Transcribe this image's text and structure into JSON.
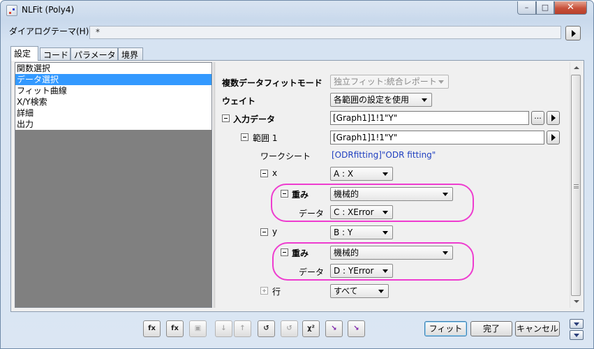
{
  "window": {
    "title": "NLFit (Poly4)",
    "min_icon": "minimize-icon",
    "max_icon": "maximize-icon",
    "close_icon": "close-icon"
  },
  "theme": {
    "label": "ダイアログテーマ(H)",
    "value": "*"
  },
  "tabs": [
    {
      "label": "設定",
      "active": true
    },
    {
      "label": "コード",
      "active": false
    },
    {
      "label": "パラメータ",
      "active": false
    },
    {
      "label": "境界",
      "active": false
    }
  ],
  "tree": {
    "items": [
      {
        "label": "関数選択",
        "selected": false
      },
      {
        "label": "データ選択",
        "selected": true
      },
      {
        "label": "フィット曲線",
        "selected": false
      },
      {
        "label": "X/Y検索",
        "selected": false
      },
      {
        "label": "詳細",
        "selected": false
      },
      {
        "label": "出力",
        "selected": false
      }
    ]
  },
  "props": {
    "multi_fit_mode": {
      "label": "複数データフィットモード",
      "value": "独立フィット:統合レポート"
    },
    "weight": {
      "label": "ウェイト",
      "value": "各範囲の設定を使用"
    },
    "input_data": {
      "label": "入力データ",
      "value": "[Graph1]1!1\"Y\"",
      "browse": "..."
    },
    "range1": {
      "label": "範囲 1",
      "value": "[Graph1]1!1\"Y\""
    },
    "worksheet": {
      "label": "ワークシート",
      "value": "[ODRfitting]\"ODR fitting\""
    },
    "x": {
      "label": "x",
      "value": "A : X"
    },
    "x_weight": {
      "label": "重み",
      "value": "機械的"
    },
    "x_data": {
      "label": "データ",
      "value": "C : XError"
    },
    "y": {
      "label": "y",
      "value": "B : Y"
    },
    "y_weight": {
      "label": "重み",
      "value": "機械的"
    },
    "y_data": {
      "label": "データ",
      "value": "D : YError"
    },
    "rows": {
      "label": "行",
      "value": "すべて"
    }
  },
  "toolbar": {
    "icons": [
      {
        "name": "fit-function-builder-icon",
        "glyph": "fx",
        "disabled": false
      },
      {
        "name": "function-organizer-icon",
        "glyph": "fx",
        "disabled": false
      },
      {
        "name": "save-icon",
        "glyph": "▣",
        "disabled": true
      },
      {
        "name": "sort-down-icon",
        "glyph": "↓",
        "disabled": true
      },
      {
        "name": "sort-up-icon",
        "glyph": "↑",
        "disabled": true
      },
      {
        "name": "init-params-icon",
        "glyph": "↺",
        "disabled": false
      },
      {
        "name": "simplex-icon",
        "glyph": "↺",
        "disabled": true
      },
      {
        "name": "chi-square-icon",
        "glyph": "χ²",
        "disabled": false
      },
      {
        "name": "one-iteration-icon",
        "glyph": "↘",
        "disabled": false
      },
      {
        "name": "fit-till-converged-icon",
        "glyph": "↘",
        "disabled": false
      }
    ]
  },
  "buttons": {
    "fit": "フィット",
    "done": "完了",
    "cancel": "キャンセル"
  },
  "colors": {
    "highlight_ring": "#ee3ccf",
    "selection": "#3399ff",
    "link_text": "#2040c0"
  }
}
